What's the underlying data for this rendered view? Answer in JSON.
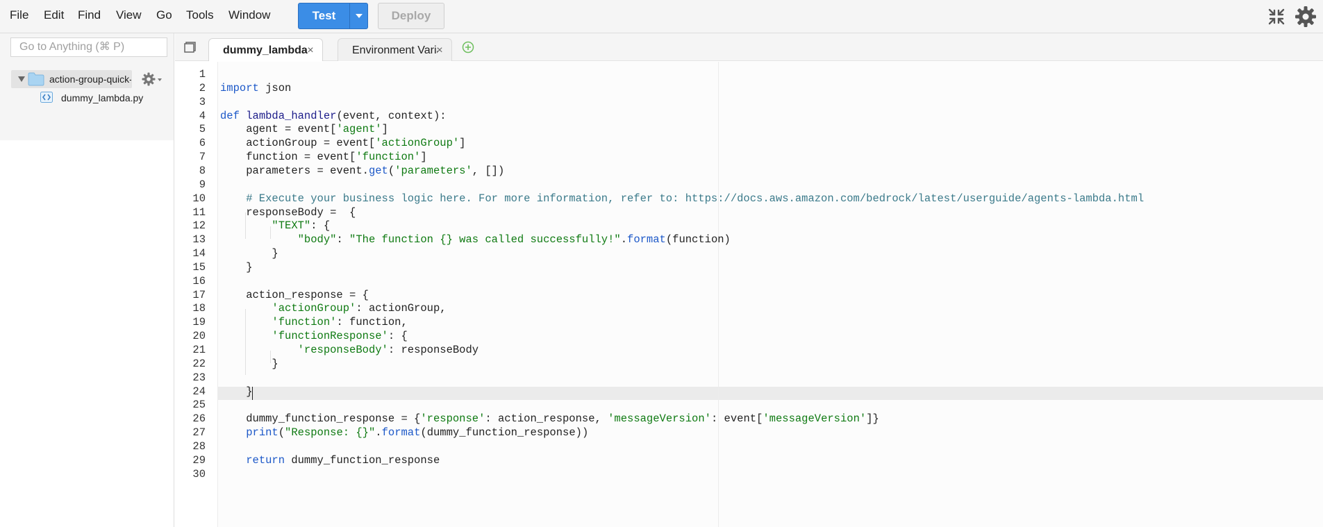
{
  "menu": {
    "file": "File",
    "edit": "Edit",
    "find": "Find",
    "view": "View",
    "go": "Go",
    "tools": "Tools",
    "window": "Window"
  },
  "toolbar": {
    "test_label": "Test",
    "deploy_label": "Deploy"
  },
  "sidebar": {
    "search_placeholder": "Go to Anything (⌘ P)",
    "folder_label": "action-group-quick-start",
    "file_label": "dummy_lambda.py"
  },
  "tabs": [
    {
      "label": "dummy_lambda.py",
      "close": "×",
      "active": true
    },
    {
      "label": "Environment Variables",
      "close": "×",
      "active": false
    }
  ],
  "editor": {
    "line_numbers": [
      "1",
      "2",
      "3",
      "4",
      "5",
      "6",
      "7",
      "8",
      "9",
      "10",
      "11",
      "12",
      "13",
      "14",
      "15",
      "16",
      "17",
      "18",
      "19",
      "20",
      "21",
      "22",
      "23",
      "24",
      "25",
      "26",
      "27",
      "28",
      "29",
      "30"
    ],
    "active_line": 24,
    "lines": [
      [],
      [
        [
          "kw",
          "import"
        ],
        [
          "t",
          " json"
        ]
      ],
      [],
      [
        [
          "kw",
          "def"
        ],
        [
          "t",
          " "
        ],
        [
          "fn",
          "lambda_handler"
        ],
        [
          "t",
          "(event, context):"
        ]
      ],
      [
        [
          "t",
          "    agent = event["
        ],
        [
          "str",
          "'agent'"
        ],
        [
          "t",
          "]"
        ]
      ],
      [
        [
          "t",
          "    actionGroup = event["
        ],
        [
          "str",
          "'actionGroup'"
        ],
        [
          "t",
          "]"
        ]
      ],
      [
        [
          "t",
          "    function = event["
        ],
        [
          "str",
          "'function'"
        ],
        [
          "t",
          "]"
        ]
      ],
      [
        [
          "t",
          "    parameters = event."
        ],
        [
          "call",
          "get"
        ],
        [
          "t",
          "("
        ],
        [
          "str",
          "'parameters'"
        ],
        [
          "t",
          ", []) "
        ]
      ],
      [],
      [
        [
          "cm",
          "    # Execute your business logic here. For more information, refer to: https://docs.aws.amazon.com/bedrock/latest/userguide/agents-lambda.html"
        ]
      ],
      [
        [
          "t",
          "    responseBody =  {"
        ]
      ],
      [
        [
          "t",
          "        "
        ],
        [
          "str",
          "\"TEXT\""
        ],
        [
          "t",
          ": {"
        ]
      ],
      [
        [
          "t",
          "            "
        ],
        [
          "str",
          "\"body\""
        ],
        [
          "t",
          ": "
        ],
        [
          "str",
          "\"The function {} was called successfully!\""
        ],
        [
          "t",
          "."
        ],
        [
          "call",
          "format"
        ],
        [
          "t",
          "(function)"
        ]
      ],
      [
        [
          "t",
          "        }"
        ]
      ],
      [
        [
          "t",
          "    }"
        ]
      ],
      [],
      [
        [
          "t",
          "    action_response = {"
        ]
      ],
      [
        [
          "t",
          "        "
        ],
        [
          "str",
          "'actionGroup'"
        ],
        [
          "t",
          ": actionGroup,"
        ]
      ],
      [
        [
          "t",
          "        "
        ],
        [
          "str",
          "'function'"
        ],
        [
          "t",
          ": function,"
        ]
      ],
      [
        [
          "t",
          "        "
        ],
        [
          "str",
          "'functionResponse'"
        ],
        [
          "t",
          ": {"
        ]
      ],
      [
        [
          "t",
          "            "
        ],
        [
          "str",
          "'responseBody'"
        ],
        [
          "t",
          ": responseBody"
        ]
      ],
      [
        [
          "t",
          "        }"
        ]
      ],
      [],
      [
        [
          "t",
          "    }"
        ]
      ],
      [],
      [
        [
          "t",
          "    dummy_function_response = {"
        ],
        [
          "str",
          "'response'"
        ],
        [
          "t",
          ": action_response, "
        ],
        [
          "str",
          "'messageVersion'"
        ],
        [
          "t",
          ": event["
        ],
        [
          "str",
          "'messageVersion'"
        ],
        [
          "t",
          "]}"
        ]
      ],
      [
        [
          "t",
          "    "
        ],
        [
          "call",
          "print"
        ],
        [
          "t",
          "("
        ],
        [
          "str",
          "\"Response: {}\""
        ],
        [
          "t",
          "."
        ],
        [
          "call",
          "format"
        ],
        [
          "t",
          "(dummy_function_response))"
        ]
      ],
      [],
      [
        [
          "t",
          "    "
        ],
        [
          "kw",
          "return"
        ],
        [
          "t",
          " dummy_function_response"
        ]
      ],
      []
    ]
  },
  "colors": {
    "accent": "#3b8de6",
    "keyword": "#1c58c8",
    "string": "#0f7a12",
    "comment": "#3b7a8a"
  },
  "icons": {
    "collapse": "collapse-arrows-icon",
    "settings": "gear-icon",
    "folder": "folder-icon",
    "file": "python-file-icon",
    "add_tab": "plus-circle-icon"
  }
}
